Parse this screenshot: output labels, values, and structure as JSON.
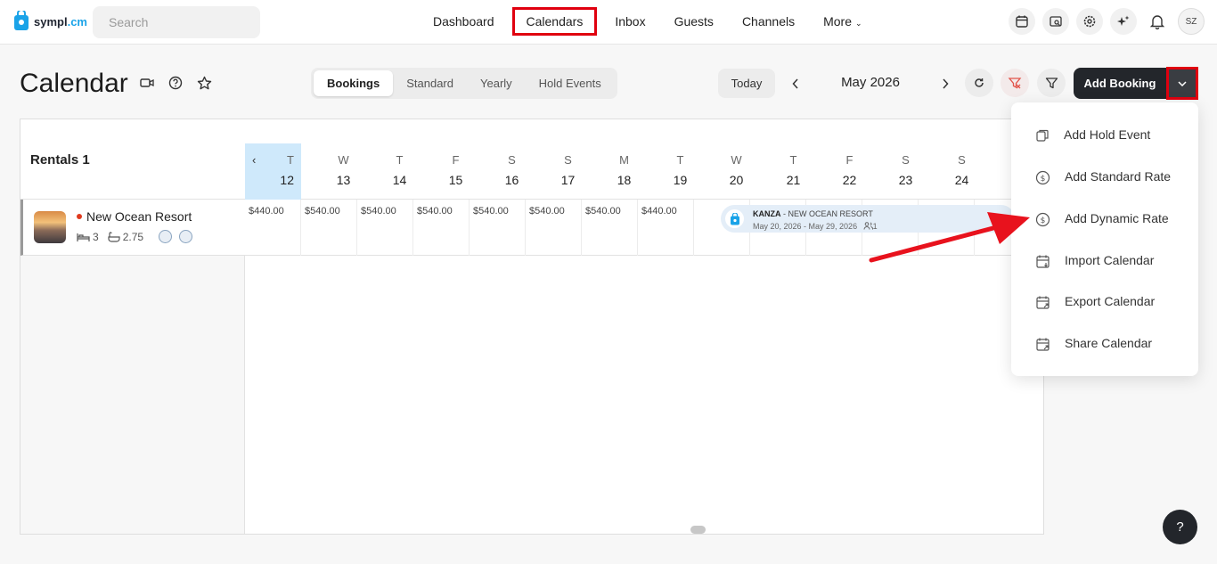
{
  "brand": {
    "name_prefix": "sympl",
    "name_suffix": ".cm",
    "accent": "#1aa3e8"
  },
  "search": {
    "placeholder": "Search"
  },
  "nav": {
    "items": [
      {
        "label": "Dashboard"
      },
      {
        "label": "Calendars",
        "active": true
      },
      {
        "label": "Inbox"
      },
      {
        "label": "Guests"
      },
      {
        "label": "Channels"
      },
      {
        "label": "More"
      }
    ]
  },
  "user": {
    "initials": "SZ"
  },
  "page": {
    "title": "Calendar",
    "view_tabs": [
      "Bookings",
      "Standard",
      "Yearly",
      "Hold Events"
    ],
    "selected_tab": "Bookings",
    "today_label": "Today",
    "month": "May 2026",
    "add_booking_label": "Add Booking"
  },
  "grid": {
    "rentals_title": "Rentals 1",
    "days": [
      {
        "letter": "T",
        "num": "12",
        "today": true
      },
      {
        "letter": "W",
        "num": "13"
      },
      {
        "letter": "T",
        "num": "14"
      },
      {
        "letter": "F",
        "num": "15"
      },
      {
        "letter": "S",
        "num": "16"
      },
      {
        "letter": "S",
        "num": "17"
      },
      {
        "letter": "M",
        "num": "18"
      },
      {
        "letter": "T",
        "num": "19"
      },
      {
        "letter": "W",
        "num": "20"
      },
      {
        "letter": "T",
        "num": "21"
      },
      {
        "letter": "F",
        "num": "22"
      },
      {
        "letter": "S",
        "num": "23"
      },
      {
        "letter": "S",
        "num": "24"
      }
    ],
    "rental": {
      "name": "New Ocean Resort",
      "bedrooms": "3",
      "bathrooms": "2.75",
      "rates": [
        "$440.00",
        "$540.00",
        "$540.00",
        "$540.00",
        "$540.00",
        "$540.00",
        "$540.00",
        "$440.00"
      ]
    },
    "booking": {
      "guest": "KANZA",
      "separator": " - ",
      "property": "NEW OCEAN RESORT",
      "dates": "May 20, 2026 - May 29, 2026",
      "guests": "1"
    }
  },
  "menu": {
    "items": [
      {
        "label": "Add Hold Event",
        "icon": "hold-event-icon"
      },
      {
        "label": "Add Standard Rate",
        "icon": "dollar-circle-icon"
      },
      {
        "label": "Add Dynamic Rate",
        "icon": "dollar-circle-icon"
      },
      {
        "label": "Import Calendar",
        "icon": "calendar-import-icon"
      },
      {
        "label": "Export Calendar",
        "icon": "calendar-export-icon"
      },
      {
        "label": "Share Calendar",
        "icon": "calendar-share-icon"
      }
    ]
  },
  "help": {
    "label": "?"
  }
}
